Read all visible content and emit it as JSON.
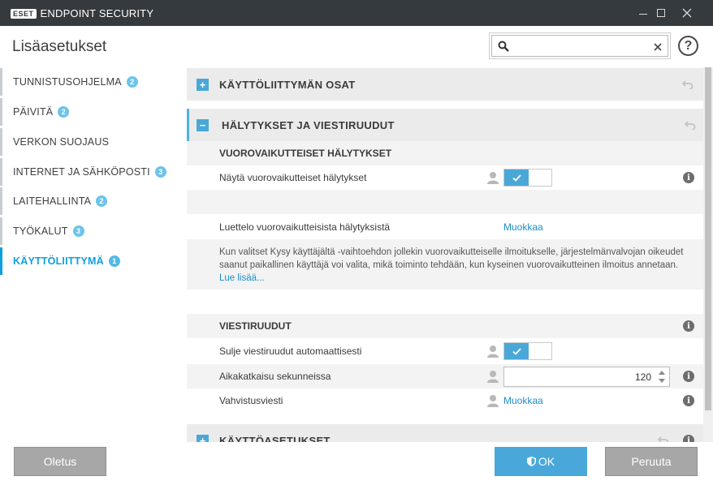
{
  "app": {
    "logo": "ESET",
    "title": "ENDPOINT SECURITY"
  },
  "window": {
    "minimize_icon": "minimize-icon",
    "maximize_icon": "maximize-icon",
    "close_icon": "close-icon"
  },
  "header": {
    "title": "Lisäasetukset",
    "search": {
      "value": "",
      "placeholder": ""
    },
    "help": "?"
  },
  "sidebar": {
    "items": [
      {
        "label": "TUNNISTUSOHJELMA",
        "badge": "2"
      },
      {
        "label": "PÄIVITÄ",
        "badge": "2"
      },
      {
        "label": "VERKON SUOJAUS",
        "badge": ""
      },
      {
        "label": "INTERNET JA SÄHKÖPOSTI",
        "badge": "3"
      },
      {
        "label": "LAITEHALLINTA",
        "badge": "2"
      },
      {
        "label": "TYÖKALUT",
        "badge": "3"
      },
      {
        "label": "KÄYTTÖLIITTYMÄ",
        "badge": "1",
        "active": true
      }
    ]
  },
  "content": {
    "sections": [
      {
        "title": "KÄYTTÖLIITTYMÄN OSAT",
        "toggle": "+"
      },
      {
        "title": "HÄLYTYKSET JA VIESTIRUUDUT",
        "toggle": "−"
      },
      {
        "title": "KÄYTTÖASETUKSET",
        "toggle": "+"
      }
    ],
    "interactive": {
      "heading": "VUOROVAIKUTTEISET HÄLYTYKSET",
      "show_label": "Näytä vuorovaikutteiset hälytykset",
      "show_enabled": true,
      "list_label": "Luettelo vuorovaikutteisista hälytyksistä",
      "list_link": "Muokkaa",
      "description": "Kun valitset Kysy käyttäjältä -vaihtoehdon jollekin vuorovaikutteiselle ilmoitukselle, järjestelmänvalvojan oikeudet saanut paikallinen käyttäjä voi valita, mikä toiminto tehdään, kun kyseinen vuorovaikutteinen ilmoitus annetaan.",
      "read_more": "Lue lisää..."
    },
    "message_boxes": {
      "heading": "VIESTIRUUDUT",
      "autoclose_label": "Sulje viestiruudut automaattisesti",
      "autoclose_enabled": true,
      "timeout_label": "Aikakatkaisu sekunneissa",
      "timeout_value": "120",
      "confirm_label": "Vahvistusviesti",
      "confirm_link": "Muokkaa"
    }
  },
  "footer": {
    "default_label": "Oletus",
    "ok_label": "OK",
    "cancel_label": "Peruuta"
  },
  "colors": {
    "accent": "#4aa8d8",
    "active_nav": "#0e9fdc",
    "titlebar": "#353a3f"
  }
}
